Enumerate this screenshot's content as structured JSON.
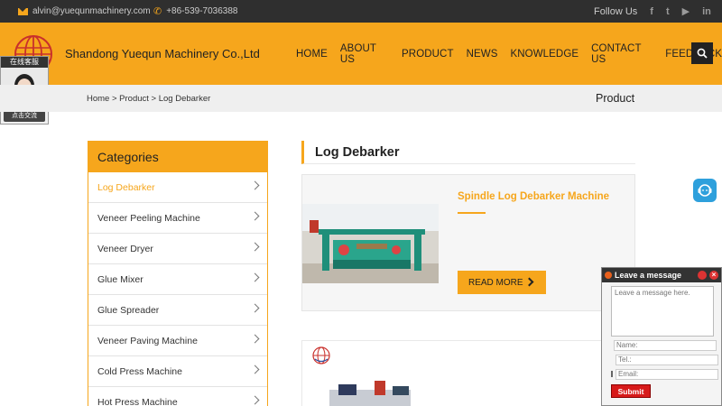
{
  "topbar": {
    "email": "alvin@yuequnmachinery.com",
    "phone": "+86-539-7036388",
    "follow_label": "Follow Us",
    "social": [
      {
        "icon": "facebook-icon",
        "glyph": "f"
      },
      {
        "icon": "twitter-icon",
        "glyph": "t"
      },
      {
        "icon": "youtube-icon",
        "glyph": "▶"
      },
      {
        "icon": "linkedin-icon",
        "glyph": "in"
      }
    ]
  },
  "header": {
    "company": "Shandong Yuequn Machinery Co.,Ltd",
    "nav": [
      "HOME",
      "ABOUT US",
      "PRODUCT",
      "NEWS",
      "KNOWLEDGE",
      "CONTACT US",
      "FEEDBACK"
    ]
  },
  "chat_widget": {
    "label": "在线客服",
    "button": "点击交流"
  },
  "breadcrumb": {
    "text": "Home > Product > Log Debarker",
    "section_title": "Product"
  },
  "categories": {
    "title": "Categories",
    "items": [
      {
        "label": "Log Debarker",
        "active": true
      },
      {
        "label": "Veneer Peeling Machine",
        "active": false
      },
      {
        "label": "Veneer Dryer",
        "active": false
      },
      {
        "label": "Glue Mixer",
        "active": false
      },
      {
        "label": "Glue Spreader",
        "active": false
      },
      {
        "label": "Veneer Paving Machine",
        "active": false
      },
      {
        "label": "Cold Press Machine",
        "active": false
      },
      {
        "label": "Hot Press Machine",
        "active": false
      }
    ]
  },
  "main": {
    "title": "Log Debarker",
    "products": [
      {
        "name": "Spindle Log Debarker Machine",
        "cta": "READ MORE"
      }
    ]
  },
  "message_widget": {
    "title": "Leave a message",
    "placeholder": "Leave a message here.",
    "name_label": "Name:",
    "tel_label": "Tel.:",
    "email_label": "Email:",
    "submit": "Submit"
  },
  "colors": {
    "accent": "#f6a61c",
    "topbar": "#2f2f2f",
    "submit": "#d71a1a"
  }
}
